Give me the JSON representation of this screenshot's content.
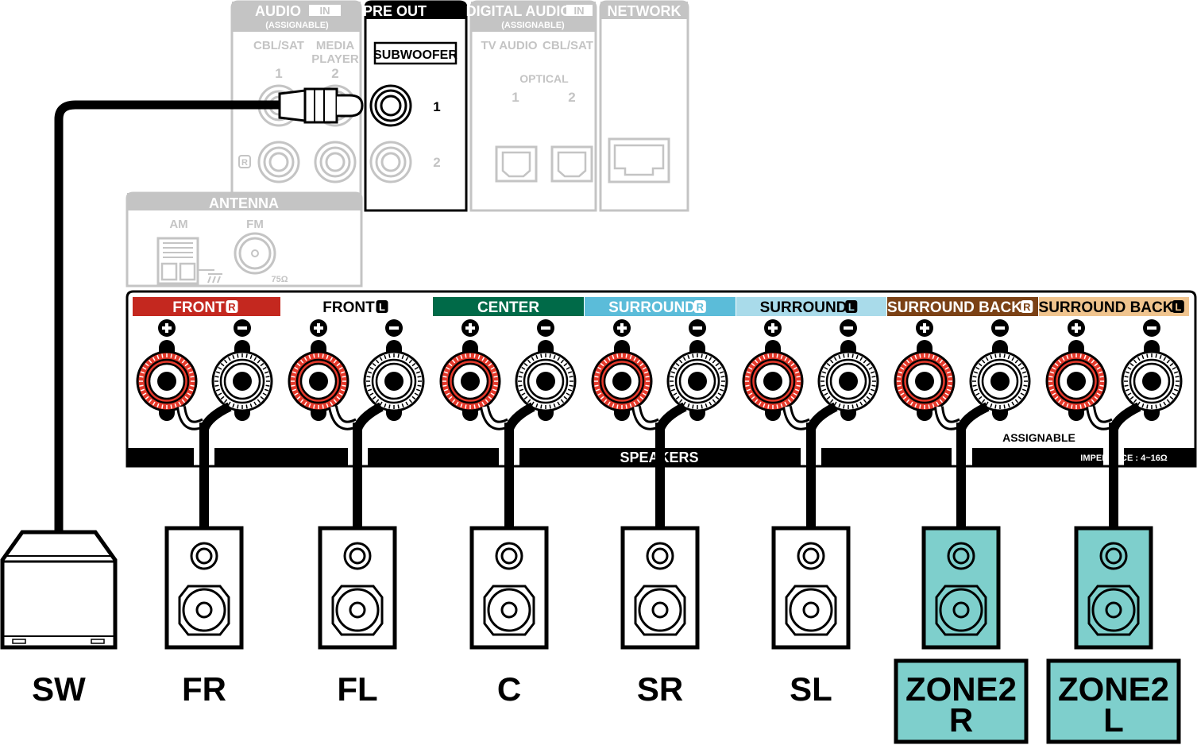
{
  "audio_in": {
    "title": "AUDIO",
    "badge": "IN",
    "sub": "(ASSIGNABLE)",
    "inputs": [
      {
        "name": "CBL/SAT",
        "num": "1"
      },
      {
        "name": "MEDIA",
        "name2": "PLAYER",
        "num": "2"
      }
    ],
    "r_mark": "R"
  },
  "pre_out": {
    "title": "PRE OUT",
    "label": "SUBWOOFER",
    "jacks": [
      "1",
      "2"
    ]
  },
  "digital_in": {
    "title": "DIGITAL AUDIO",
    "badge": "IN",
    "sub": "(ASSIGNABLE)",
    "inputs": [
      "TV AUDIO",
      "CBL/SAT"
    ],
    "type": "OPTICAL",
    "nums": [
      "1",
      "2"
    ]
  },
  "network": {
    "title": "NETWORK"
  },
  "antenna": {
    "title": "ANTENNA",
    "am": "AM",
    "fm": "FM",
    "fm_imp": "75Ω"
  },
  "speakers": {
    "title": "SPEAKERS",
    "assignable": "ASSIGNABLE",
    "impedance": "IMPEDANCE : 4~16Ω",
    "channels": [
      {
        "label": "FRONT",
        "side": "R",
        "color": "#c4281f",
        "text_color": "#ffffff",
        "speaker": "FR"
      },
      {
        "label": "FRONT",
        "side": "L",
        "color": "#ffffff",
        "text_color": "#000000",
        "speaker": "FL"
      },
      {
        "label": "CENTER",
        "side": "",
        "color": "#006a48",
        "text_color": "#ffffff",
        "speaker": "C"
      },
      {
        "label": "SURROUND",
        "side": "R",
        "color": "#5bbcd9",
        "text_color": "#ffffff",
        "speaker": "SR"
      },
      {
        "label": "SURROUND",
        "side": "L",
        "color": "#a9dbea",
        "text_color": "#000000",
        "speaker": "SL"
      },
      {
        "label": "SURROUND BACK",
        "side": "R",
        "color": "#7b4115",
        "text_color": "#ffffff",
        "speaker": "ZONE2",
        "speaker2": "R",
        "zone": true
      },
      {
        "label": "SURROUND BACK",
        "side": "L",
        "color": "#f0c48e",
        "text_color": "#000000",
        "speaker": "ZONE2",
        "speaker2": "L",
        "zone": true
      }
    ]
  },
  "subwoofer": {
    "label": "SW"
  },
  "colors": {
    "terminal_red": "#e5392b",
    "zone_fill": "#7ecfcc",
    "panel_gray": "#bdbdbd"
  }
}
